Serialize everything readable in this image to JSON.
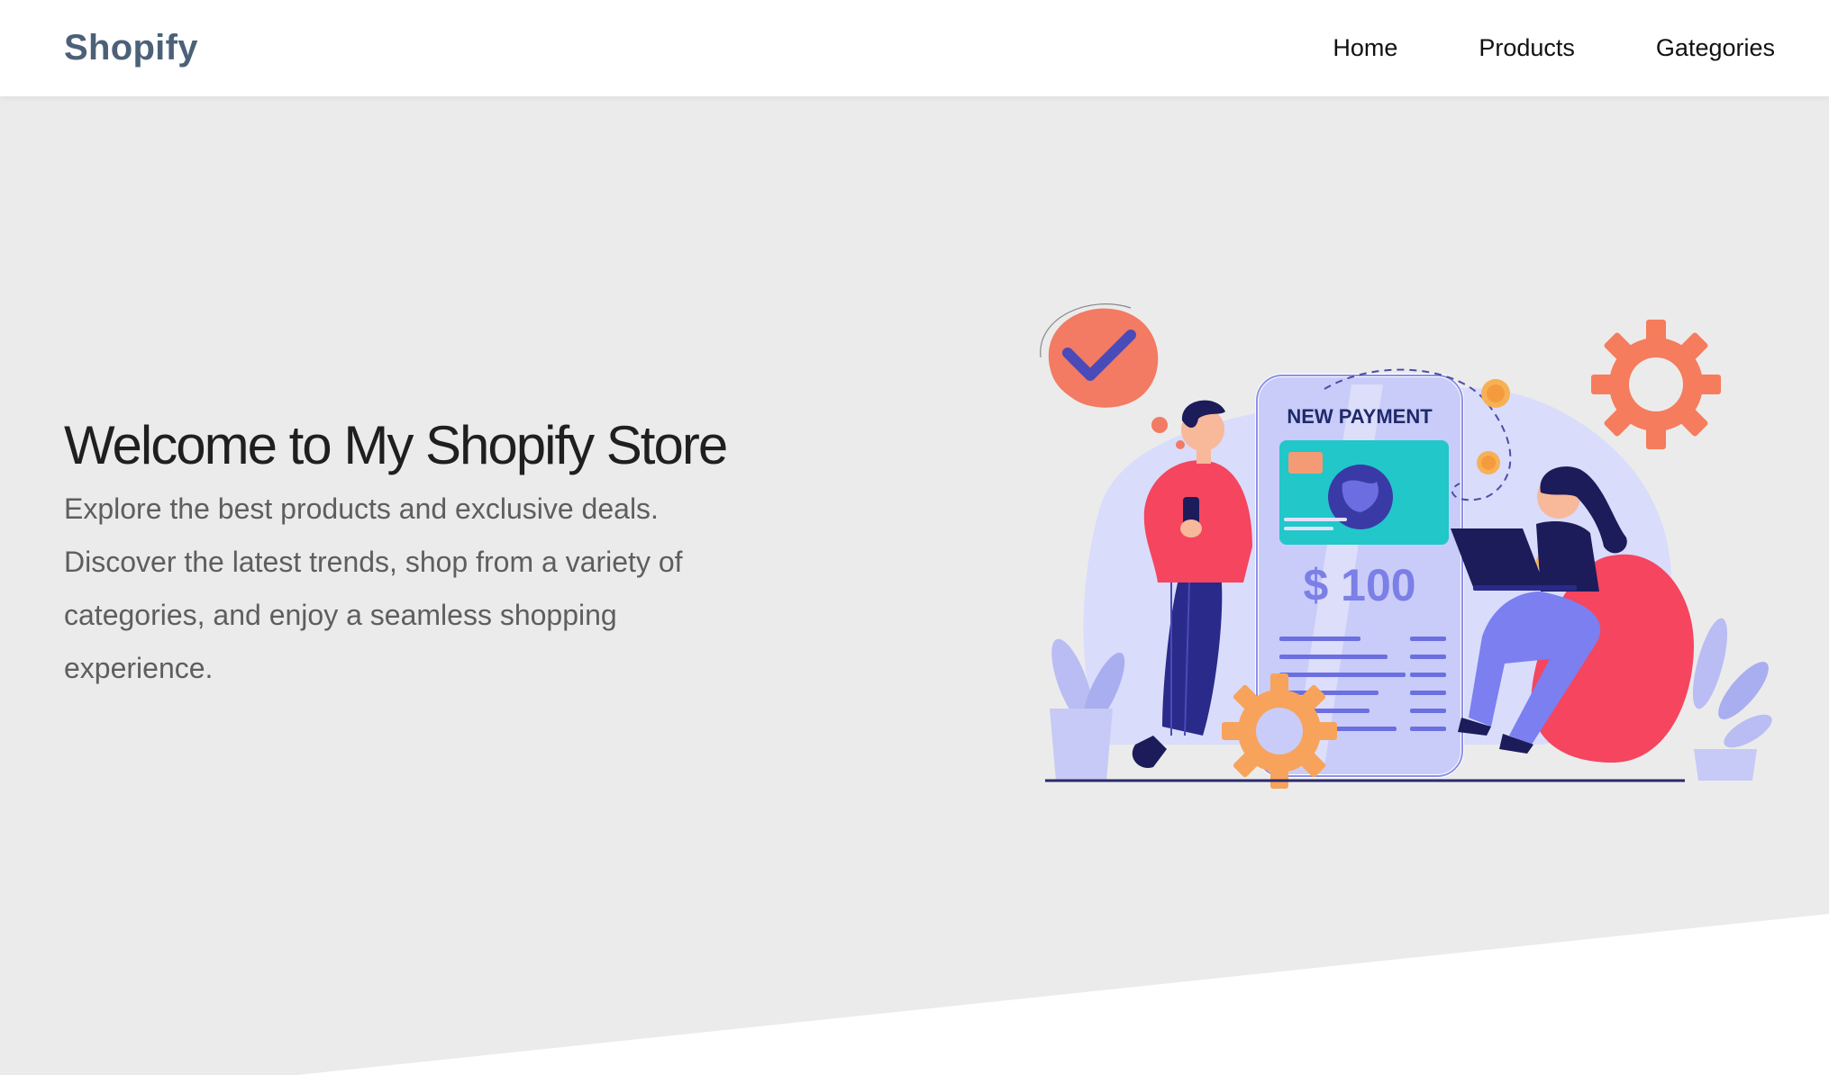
{
  "navbar": {
    "brand": "Shopify",
    "links": [
      "Home",
      "Products",
      "Gategories"
    ]
  },
  "hero": {
    "title": "Welcome to My Shopify Store",
    "description": "Explore the best products and exclusive deals. Discover the latest trends, shop from a variety of categories, and enjoy a seamless shopping experience.",
    "illustration": {
      "heading": "NEW PAYMENT",
      "amount": "$ 100"
    }
  },
  "colors": {
    "brand": "#4c6179",
    "background": "#ebebeb",
    "accent_pink": "#f2445e",
    "accent_indigo": "#2a2a8a",
    "accent_purple": "#7b7ff0"
  }
}
